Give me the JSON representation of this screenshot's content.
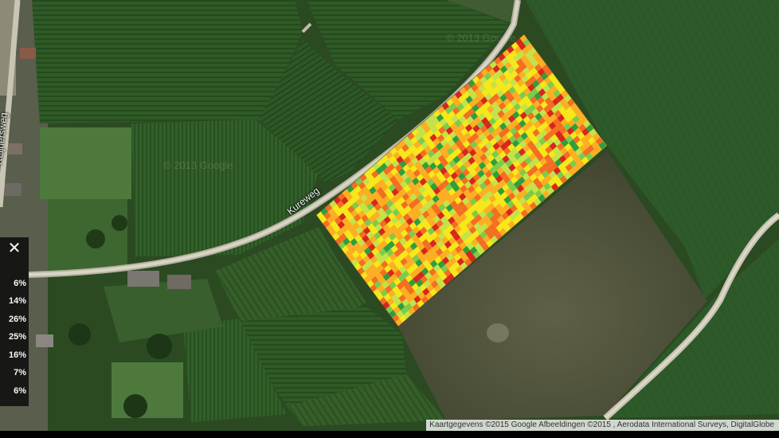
{
  "map": {
    "roads": {
      "kureweg": "Kureweg",
      "reijnersweg": "Reijnersweg"
    },
    "watermarks": {
      "w1": "© 2013 Google",
      "w2": "© 2013 Google"
    },
    "attribution": "Kaartgegevens ©2015 Google Afbeeldingen ©2015 , Aerodata International Surveys, DigitalGlobe"
  },
  "legend": {
    "close_icon": "close-icon",
    "items": [
      {
        "percent": "6%",
        "color": "#d7261e"
      },
      {
        "percent": "14%",
        "color": "#f46d23"
      },
      {
        "percent": "26%",
        "color": "#fdae24"
      },
      {
        "percent": "25%",
        "color": "#f6e81a"
      },
      {
        "percent": "16%",
        "color": "#c4e24a"
      },
      {
        "percent": "7%",
        "color": "#7ccb4c"
      },
      {
        "percent": "6%",
        "color": "#2e9e3f"
      }
    ]
  }
}
